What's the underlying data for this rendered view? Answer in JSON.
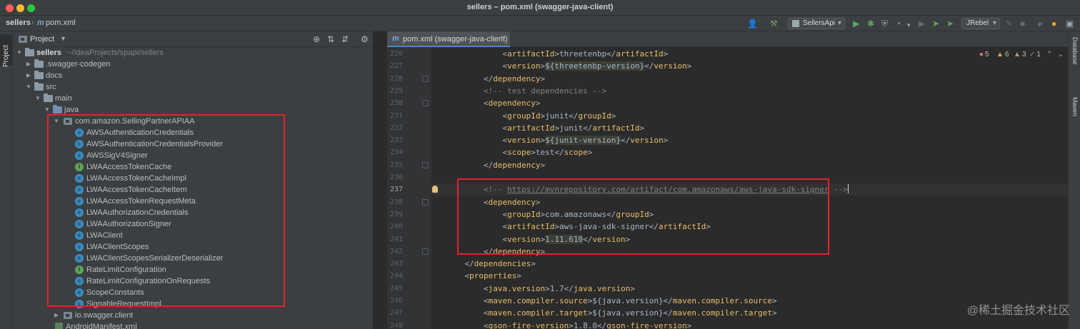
{
  "window": {
    "title": "sellers – pom.xml (swagger-java-client)"
  },
  "navbar": {
    "project": "sellers",
    "file_icon": "m",
    "file": "pom.xml",
    "run_config": "SellersApi",
    "jrebel": "JRebel"
  },
  "left_stripe": {
    "project_tab": "Project"
  },
  "project_panel": {
    "title": "Project",
    "tree": [
      {
        "label": "sellers",
        "hint": "~/IdeaProjects/spapi/sellers"
      },
      {
        "label": ".swagger-codegen"
      },
      {
        "label": "docs"
      },
      {
        "label": "src"
      },
      {
        "label": "main"
      },
      {
        "label": "java"
      },
      {
        "label": "com.amazon.SellingPartnerAPIAA"
      },
      {
        "label": "AWSAuthenticationCredentials"
      },
      {
        "label": "AWSAuthenticationCredentialsProvider"
      },
      {
        "label": "AWSSigV4Signer"
      },
      {
        "label": "LWAAccessTokenCache"
      },
      {
        "label": "LWAAccessTokenCacheImpl"
      },
      {
        "label": "LWAAccessTokenCacheItem"
      },
      {
        "label": "LWAAccessTokenRequestMeta"
      },
      {
        "label": "LWAAuthorizationCredentials"
      },
      {
        "label": "LWAAuthorizationSigner"
      },
      {
        "label": "LWAClient"
      },
      {
        "label": "LWAClientScopes"
      },
      {
        "label": "LWAClientScopesSerializerDeserializer"
      },
      {
        "label": "RateLimitConfiguration"
      },
      {
        "label": "RateLimitConfigurationOnRequests"
      },
      {
        "label": "ScopeConstants"
      },
      {
        "label": "SignableRequestImpl"
      },
      {
        "label": "io.swagger.client"
      },
      {
        "label": "AndroidManifest.xml"
      }
    ]
  },
  "editor": {
    "tab_label": "pom.xml (swagger-java-client)",
    "tab_icon": "m",
    "inspections": {
      "errors": "5",
      "warnings": "6",
      "weak": "3",
      "ok": "1"
    },
    "lines": [
      {
        "no": "226",
        "parts": [
          [
            "txt",
            "            <"
          ],
          [
            "tag",
            "artifactId"
          ],
          [
            "txt",
            ">threetenbp</"
          ],
          [
            "tag",
            "artifactId"
          ],
          [
            "txt",
            ">"
          ]
        ]
      },
      {
        "no": "227",
        "parts": [
          [
            "txt",
            "            <"
          ],
          [
            "tag",
            "version"
          ],
          [
            "txt",
            ">"
          ],
          [
            "var",
            "${threetenbp-version}"
          ],
          [
            "txt",
            "</"
          ],
          [
            "tag",
            "version"
          ],
          [
            "txt",
            ">"
          ]
        ]
      },
      {
        "no": "228",
        "parts": [
          [
            "txt",
            "        </"
          ],
          [
            "tag",
            "dependency"
          ],
          [
            "txt",
            ">"
          ]
        ]
      },
      {
        "no": "229",
        "parts": [
          [
            "cmt",
            "        <!-- test dependencies -->"
          ]
        ]
      },
      {
        "no": "230",
        "parts": [
          [
            "txt",
            "        <"
          ],
          [
            "tag",
            "dependency"
          ],
          [
            "txt",
            ">"
          ]
        ]
      },
      {
        "no": "231",
        "parts": [
          [
            "txt",
            "            <"
          ],
          [
            "tag",
            "groupId"
          ],
          [
            "txt",
            ">junit</"
          ],
          [
            "tag",
            "groupId"
          ],
          [
            "txt",
            ">"
          ]
        ]
      },
      {
        "no": "232",
        "parts": [
          [
            "txt",
            "            <"
          ],
          [
            "tag",
            "artifactId"
          ],
          [
            "txt",
            ">junit</"
          ],
          [
            "tag",
            "artifactId"
          ],
          [
            "txt",
            ">"
          ]
        ]
      },
      {
        "no": "233",
        "parts": [
          [
            "txt",
            "            <"
          ],
          [
            "tag",
            "version"
          ],
          [
            "txt",
            ">"
          ],
          [
            "var",
            "${junit-version}"
          ],
          [
            "txt",
            "</"
          ],
          [
            "tag",
            "version"
          ],
          [
            "txt",
            ">"
          ]
        ]
      },
      {
        "no": "234",
        "parts": [
          [
            "txt",
            "            <"
          ],
          [
            "tag",
            "scope"
          ],
          [
            "txt",
            ">test</"
          ],
          [
            "tag",
            "scope"
          ],
          [
            "txt",
            ">"
          ]
        ]
      },
      {
        "no": "235",
        "parts": [
          [
            "txt",
            "        </"
          ],
          [
            "tag",
            "dependency"
          ],
          [
            "txt",
            ">"
          ]
        ]
      },
      {
        "no": "236",
        "parts": []
      },
      {
        "no": "237",
        "parts": [
          [
            "cmt",
            "        <!-- "
          ],
          [
            "link",
            "https://mvnrepository.com/artifact/com.amazonaws/aws-java-sdk-signer"
          ],
          [
            "cmt",
            " -->"
          ]
        ]
      },
      {
        "no": "238",
        "parts": [
          [
            "txt",
            "        <"
          ],
          [
            "tag",
            "dependency"
          ],
          [
            "txt",
            ">"
          ]
        ]
      },
      {
        "no": "239",
        "parts": [
          [
            "txt",
            "            <"
          ],
          [
            "tag",
            "groupId"
          ],
          [
            "txt",
            ">com.amazonaws</"
          ],
          [
            "tag",
            "groupId"
          ],
          [
            "txt",
            ">"
          ]
        ]
      },
      {
        "no": "240",
        "parts": [
          [
            "txt",
            "            <"
          ],
          [
            "tag",
            "artifactId"
          ],
          [
            "txt",
            ">aws-java-sdk-signer</"
          ],
          [
            "tag",
            "artifactId"
          ],
          [
            "txt",
            ">"
          ]
        ]
      },
      {
        "no": "241",
        "parts": [
          [
            "txt",
            "            <"
          ],
          [
            "tag",
            "version"
          ],
          [
            "txt",
            ">"
          ],
          [
            "var",
            "1.11.610"
          ],
          [
            "txt",
            "</"
          ],
          [
            "tag",
            "version"
          ],
          [
            "txt",
            ">"
          ]
        ]
      },
      {
        "no": "242",
        "parts": [
          [
            "txt",
            "        </"
          ],
          [
            "tag",
            "dependency"
          ],
          [
            "txt",
            ">"
          ]
        ]
      },
      {
        "no": "243",
        "parts": [
          [
            "txt",
            "    </"
          ],
          [
            "tag",
            "dependencies"
          ],
          [
            "txt",
            ">"
          ]
        ]
      },
      {
        "no": "244",
        "parts": [
          [
            "txt",
            "    <"
          ],
          [
            "tag",
            "properties"
          ],
          [
            "txt",
            ">"
          ]
        ]
      },
      {
        "no": "245",
        "parts": [
          [
            "txt",
            "        <"
          ],
          [
            "tag",
            "java.version"
          ],
          [
            "txt",
            ">1.7</"
          ],
          [
            "tag",
            "java.version"
          ],
          [
            "txt",
            ">"
          ]
        ]
      },
      {
        "no": "246",
        "parts": [
          [
            "txt",
            "        <"
          ],
          [
            "tag",
            "maven.compiler.source"
          ],
          [
            "txt",
            ">${java.version}</"
          ],
          [
            "tag",
            "maven.compiler.source"
          ],
          [
            "txt",
            ">"
          ]
        ]
      },
      {
        "no": "247",
        "parts": [
          [
            "txt",
            "        <"
          ],
          [
            "tag",
            "maven.compiler.target"
          ],
          [
            "txt",
            ">${java.version}</"
          ],
          [
            "tag",
            "maven.compiler.target"
          ],
          [
            "txt",
            ">"
          ]
        ]
      },
      {
        "no": "248",
        "parts": [
          [
            "txt",
            "        <"
          ],
          [
            "tag",
            "gson-fire-version"
          ],
          [
            "txt",
            ">1.8.0</"
          ],
          [
            "tag",
            "gson-fire-version"
          ],
          [
            "txt",
            ">"
          ]
        ]
      }
    ]
  },
  "right_stripe": {
    "database": "Database",
    "maven": "Maven"
  },
  "watermark": "@稀土掘金技术社区",
  "colors": {
    "highlight_box": "#e0242c",
    "tag": "#e8bf6a",
    "text": "#a9b7c6",
    "comment": "#808080"
  }
}
